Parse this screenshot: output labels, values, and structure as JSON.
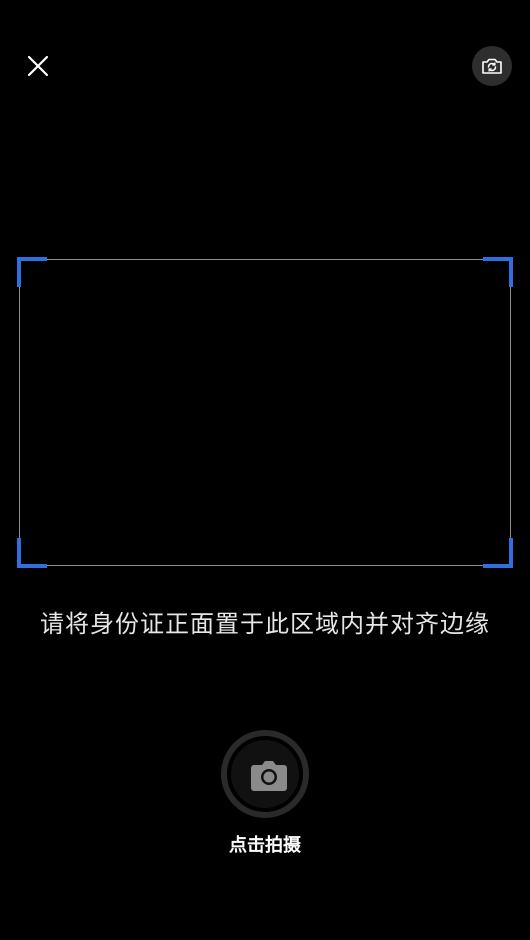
{
  "header": {
    "close_icon": "close-icon",
    "switch_camera_icon": "switch-camera-icon"
  },
  "scanner": {
    "frame_color": "#8c8c8c",
    "corner_color": "#2f6fe0",
    "hint": "请将身份证正面置于此区域内并对齐边缘"
  },
  "capture": {
    "icon": "camera-icon",
    "label": "点击拍摄"
  }
}
